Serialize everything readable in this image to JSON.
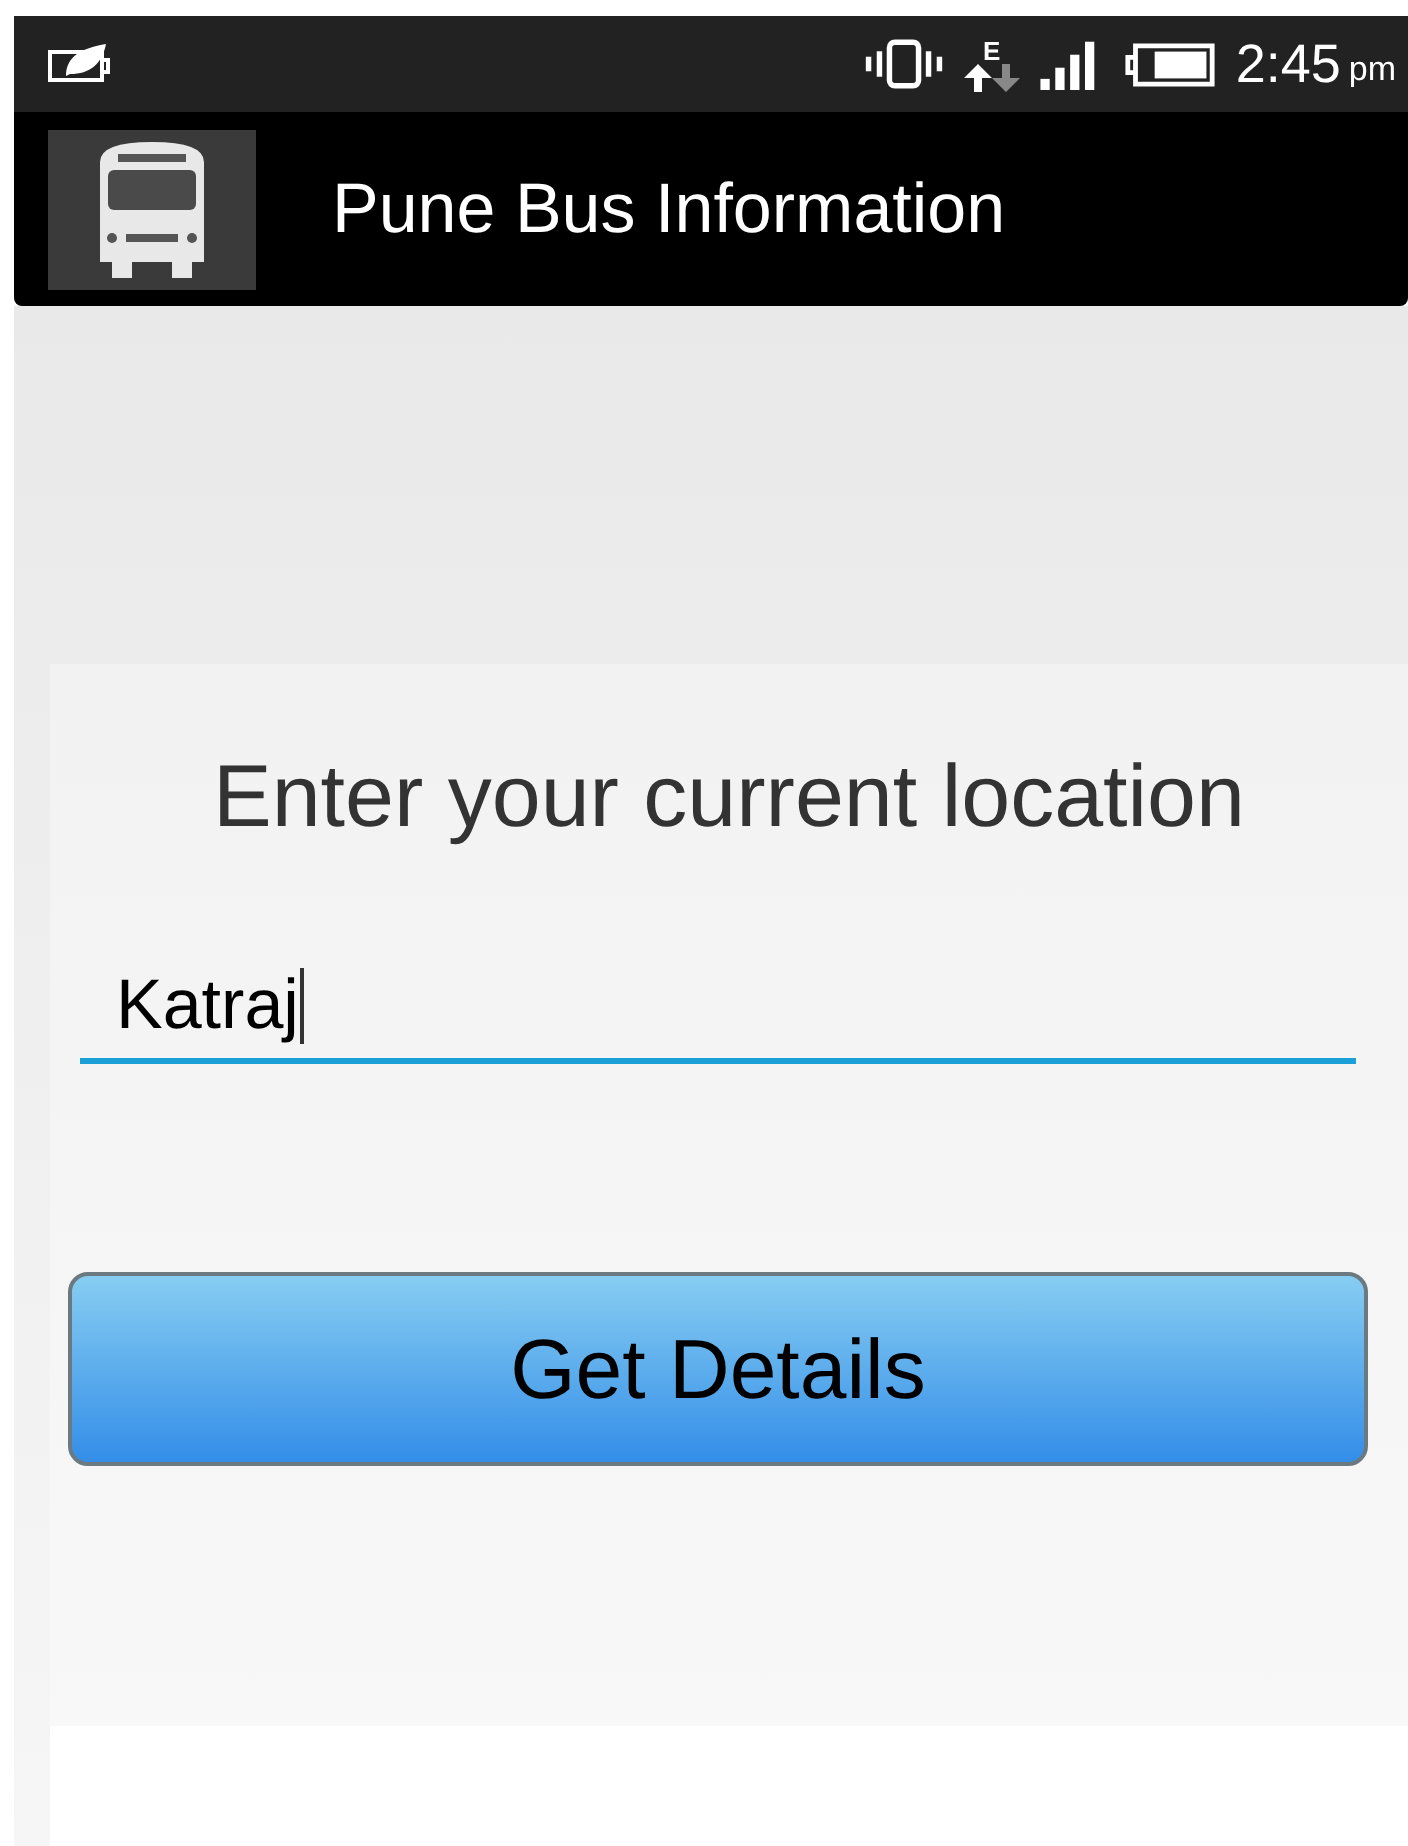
{
  "status_bar": {
    "network_type": "E",
    "time": "2:45",
    "period": "pm"
  },
  "app_bar": {
    "title": "Pune Bus Information"
  },
  "form": {
    "heading": "Enter your current location",
    "location_field": {
      "value": "Katraj",
      "focused": true
    },
    "button": "Get Details"
  }
}
